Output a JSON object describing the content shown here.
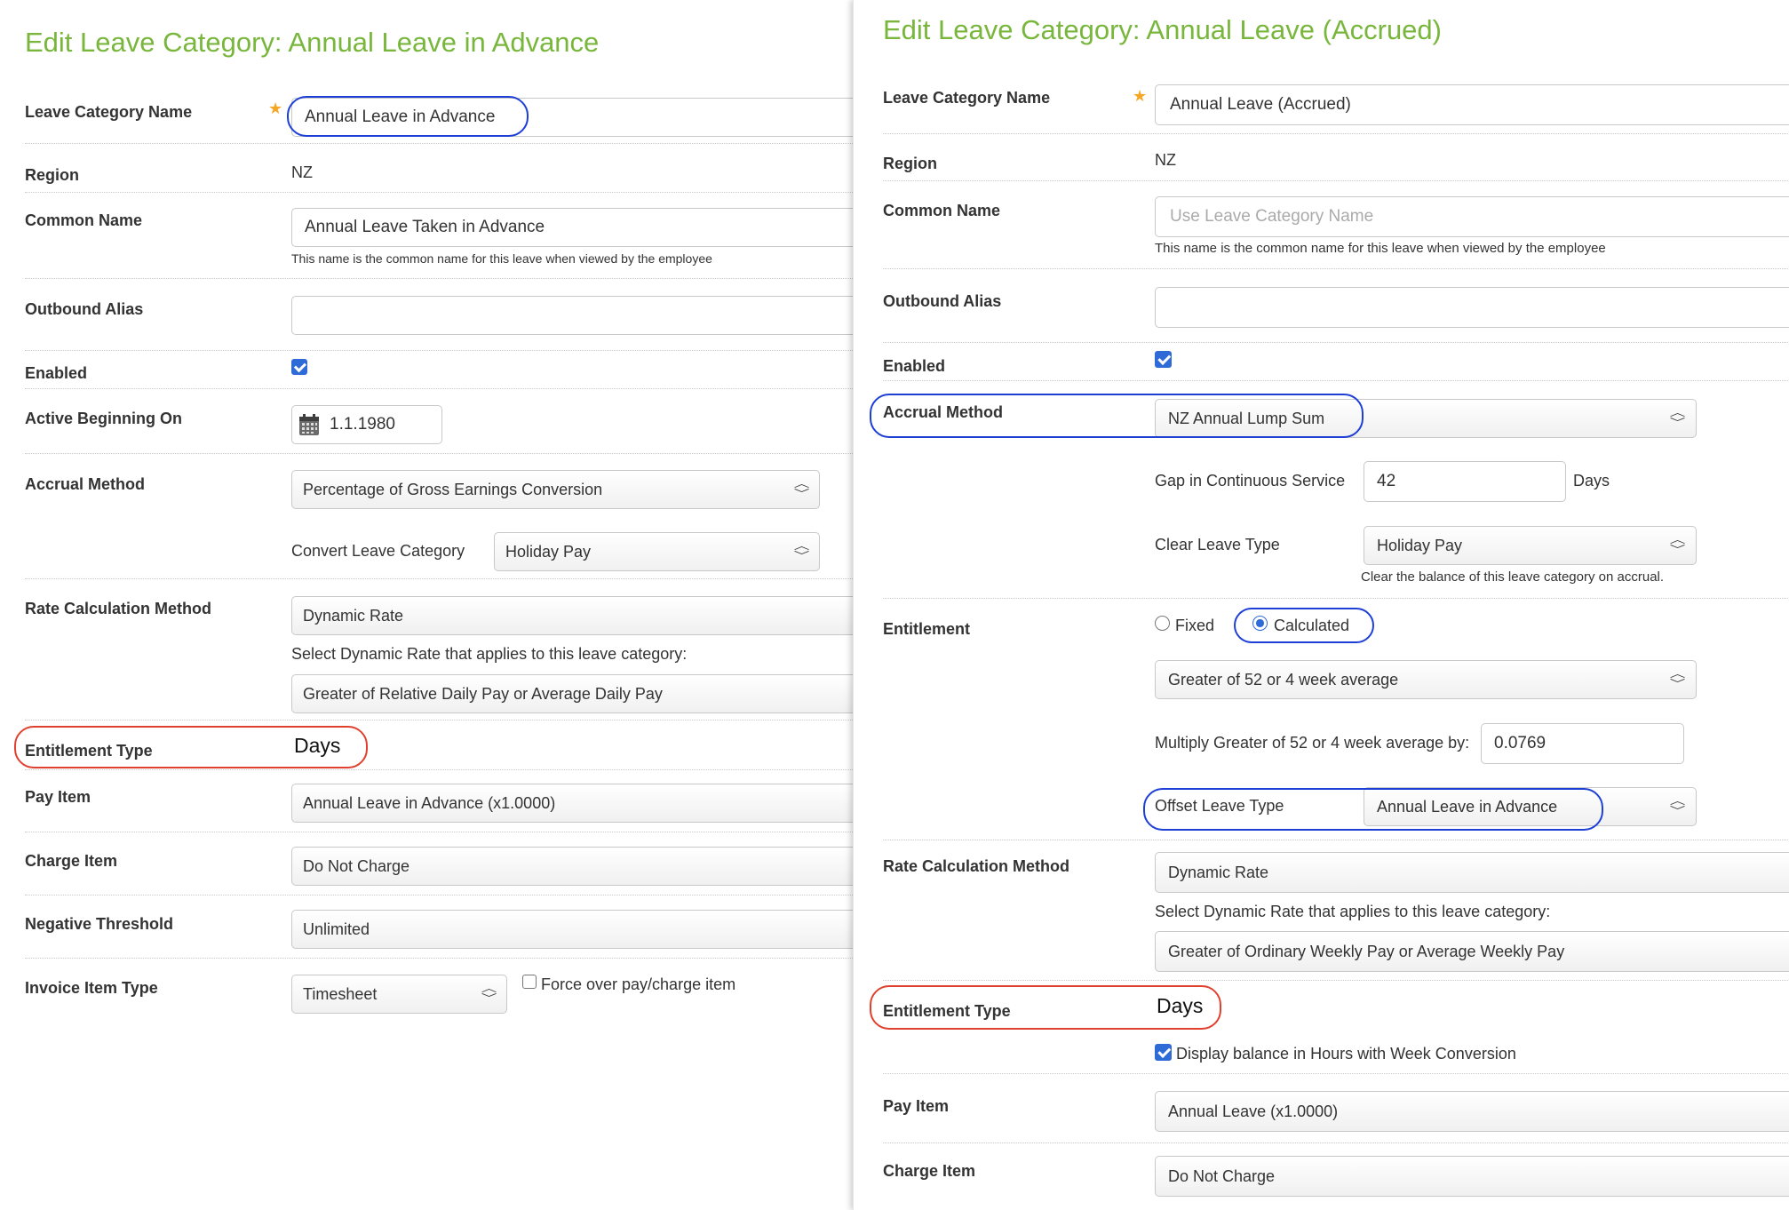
{
  "left": {
    "title": "Edit Leave Category: Annual Leave in Advance",
    "fields": {
      "leave_category_name": {
        "label": "Leave Category Name",
        "value": "Annual Leave in Advance"
      },
      "region": {
        "label": "Region",
        "value": "NZ"
      },
      "common_name": {
        "label": "Common Name",
        "value": "Annual Leave Taken in Advance",
        "hint": "This name is the common name for this leave when viewed by the employee"
      },
      "outbound_alias": {
        "label": "Outbound Alias",
        "value": ""
      },
      "enabled": {
        "label": "Enabled",
        "checked": true
      },
      "active_beginning_on": {
        "label": "Active Beginning On",
        "value": "1.1.1980"
      },
      "accrual_method": {
        "label": "Accrual Method",
        "value": "Percentage of Gross Earnings Conversion"
      },
      "convert_leave_category": {
        "label": "Convert Leave Category",
        "value": "Holiday Pay"
      },
      "rate_calculation_method": {
        "label": "Rate Calculation Method",
        "value": "Dynamic Rate",
        "hint": "Select Dynamic Rate that applies to this leave category:",
        "dynamic_value": "Greater of Relative Daily Pay or Average Daily Pay"
      },
      "entitlement_type": {
        "label": "Entitlement Type",
        "value": "Days"
      },
      "pay_item": {
        "label": "Pay Item",
        "value": "Annual Leave in Advance (x1.0000)"
      },
      "charge_item": {
        "label": "Charge Item",
        "value": "Do Not Charge"
      },
      "negative_threshold": {
        "label": "Negative Threshold",
        "value": "Unlimited"
      },
      "invoice_item_type": {
        "label": "Invoice Item Type",
        "value": "Timesheet",
        "force_label": "Force over pay/charge item",
        "force_checked": false
      }
    }
  },
  "right": {
    "title": "Edit Leave Category: Annual Leave (Accrued)",
    "fields": {
      "leave_category_name": {
        "label": "Leave Category Name",
        "value": "Annual Leave (Accrued)"
      },
      "region": {
        "label": "Region",
        "value": "NZ"
      },
      "common_name": {
        "label": "Common Name",
        "placeholder": "Use Leave Category Name",
        "hint": "This name is the common name for this leave when viewed by the employee"
      },
      "outbound_alias": {
        "label": "Outbound Alias",
        "value": ""
      },
      "enabled": {
        "label": "Enabled",
        "checked": true
      },
      "accrual_method": {
        "label": "Accrual Method",
        "value": "NZ Annual Lump Sum"
      },
      "gap_in_continuous_service": {
        "label": "Gap in Continuous Service",
        "value": "42",
        "unit": "Days"
      },
      "clear_leave_type": {
        "label": "Clear Leave Type",
        "value": "Holiday Pay",
        "hint": "Clear the balance of this leave category on accrual."
      },
      "entitlement": {
        "label": "Entitlement",
        "options": [
          "Fixed",
          "Calculated"
        ],
        "selected": "Calculated",
        "method": "Greater of 52 or 4 week average",
        "multiply_label": "Multiply Greater of 52 or 4 week average by:",
        "multiply_value": "0.0769",
        "offset_label": "Offset Leave Type",
        "offset_value": "Annual Leave in Advance"
      },
      "rate_calculation_method": {
        "label": "Rate Calculation Method",
        "value": "Dynamic Rate",
        "hint": "Select Dynamic Rate that applies to this leave category:",
        "dynamic_value": "Greater of Ordinary Weekly Pay or Average Weekly Pay"
      },
      "entitlement_type": {
        "label": "Entitlement Type",
        "value": "Days",
        "display_balance_label": "Display balance in Hours with Week Conversion",
        "display_balance_checked": true
      },
      "pay_item": {
        "label": "Pay Item",
        "value": "Annual Leave (x1.0000)"
      },
      "charge_item": {
        "label": "Charge Item",
        "value": "Do Not Charge"
      }
    }
  },
  "colors": {
    "title_green": "#78b63c",
    "highlight_blue": "#1d3fd6",
    "highlight_red": "#e0402e",
    "checkbox_blue": "#2f6bd6",
    "required_star": "#f5a623"
  },
  "icons": {
    "required": "star-icon",
    "calendar": "calendar-icon",
    "select_arrows": "select-arrows-icon"
  }
}
